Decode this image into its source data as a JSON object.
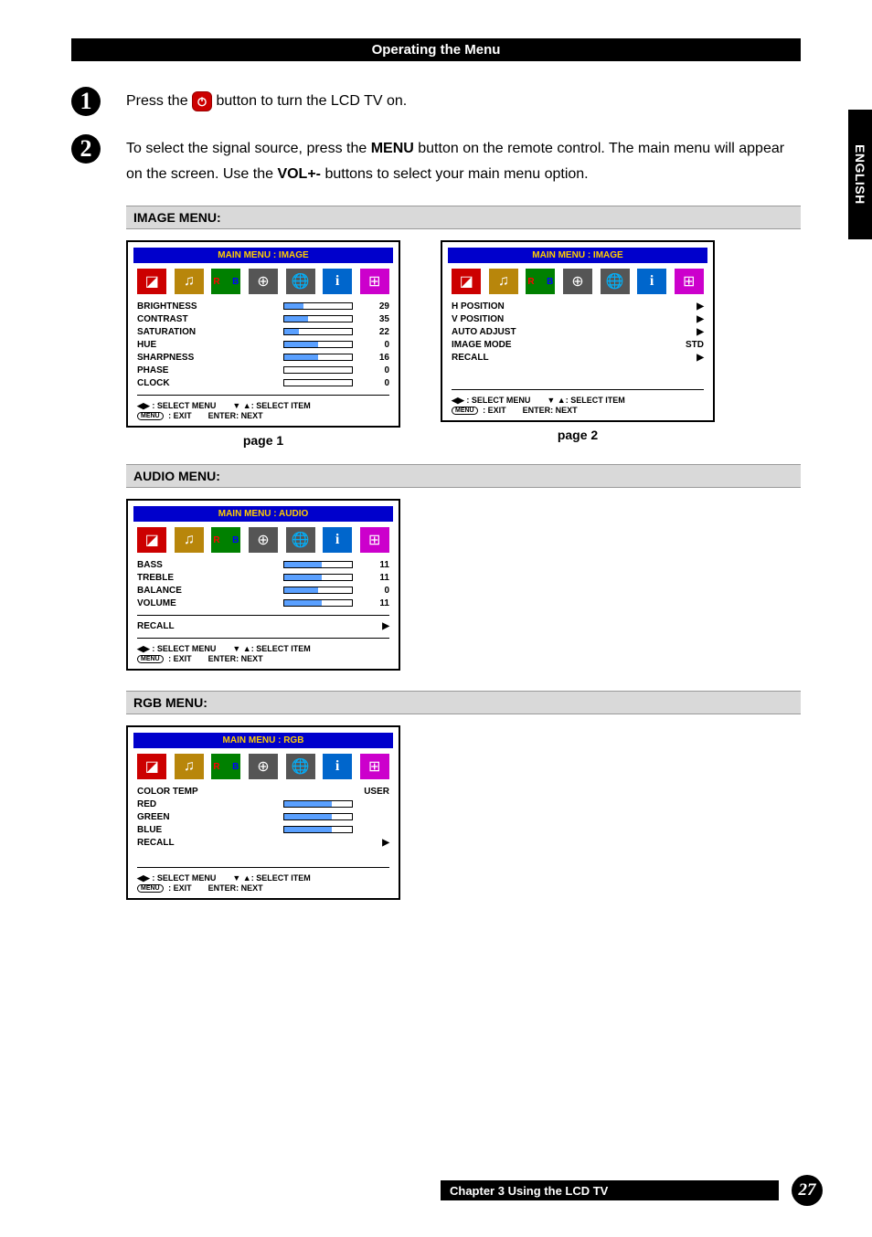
{
  "header": {
    "title": "Operating the Menu"
  },
  "sideTab": "ENGLISH",
  "steps": {
    "s1": {
      "pre": "Press the ",
      "post": " button to turn the LCD TV on."
    },
    "s2": {
      "t1": "To select the signal source, press the ",
      "b1": "MENU",
      "t2": " button on the remote control. The main menu will appear on the screen. Use the ",
      "b2": "VOL+-",
      "t3": " buttons to select your main menu option."
    }
  },
  "headings": {
    "image": "IMAGE MENU:",
    "audio": "AUDIO MENU:",
    "rgb": "RGB MENU:"
  },
  "panelTitles": {
    "image": "MAIN MENU : IMAGE",
    "audio": "MAIN MENU : AUDIO",
    "rgb": "MAIN MENU : RGB"
  },
  "imageP1": [
    {
      "lbl": "BRIGHTNESS",
      "val": "29",
      "pct": 29
    },
    {
      "lbl": "CONTRAST",
      "val": "35",
      "pct": 35
    },
    {
      "lbl": "SATURATION",
      "val": "22",
      "pct": 22
    },
    {
      "lbl": "HUE",
      "val": "0",
      "pct": 50
    },
    {
      "lbl": "SHARPNESS",
      "val": "16",
      "pct": 50
    },
    {
      "lbl": "PHASE",
      "val": "0",
      "pct": 0
    },
    {
      "lbl": "CLOCK",
      "val": "0",
      "pct": 0
    }
  ],
  "imageP2": [
    {
      "lbl": "H POSITION",
      "val": "▶"
    },
    {
      "lbl": "V POSITION",
      "val": "▶"
    },
    {
      "lbl": "AUTO ADJUST",
      "val": "▶"
    },
    {
      "lbl": "IMAGE MODE",
      "val": "STD"
    },
    {
      "lbl": "RECALL",
      "val": "▶"
    }
  ],
  "audio": {
    "rows": [
      {
        "lbl": "BASS",
        "val": "11",
        "pct": 55
      },
      {
        "lbl": "TREBLE",
        "val": "11",
        "pct": 55
      },
      {
        "lbl": "BALANCE",
        "val": "0",
        "pct": 50
      },
      {
        "lbl": "VOLUME",
        "val": "11",
        "pct": 55
      }
    ],
    "recall": {
      "lbl": "RECALL",
      "val": "▶"
    }
  },
  "rgb": {
    "colortemp": {
      "lbl": "COLOR TEMP",
      "val": "USER"
    },
    "rows": [
      {
        "lbl": "RED",
        "pct": 70
      },
      {
        "lbl": "GREEN",
        "pct": 70
      },
      {
        "lbl": "BLUE",
        "pct": 70
      }
    ],
    "recall": {
      "lbl": "RECALL",
      "val": "▶"
    }
  },
  "hints": {
    "selectMenu": ": SELECT MENU",
    "selectItem": ": SELECT ITEM",
    "exit": ": EXIT",
    "enter": "ENTER: NEXT",
    "menuPill": "MENU"
  },
  "pageLabels": {
    "p1": "page 1",
    "p2": "page 2"
  },
  "footer": {
    "chapter": "Chapter 3 Using the LCD TV",
    "page": "27"
  }
}
